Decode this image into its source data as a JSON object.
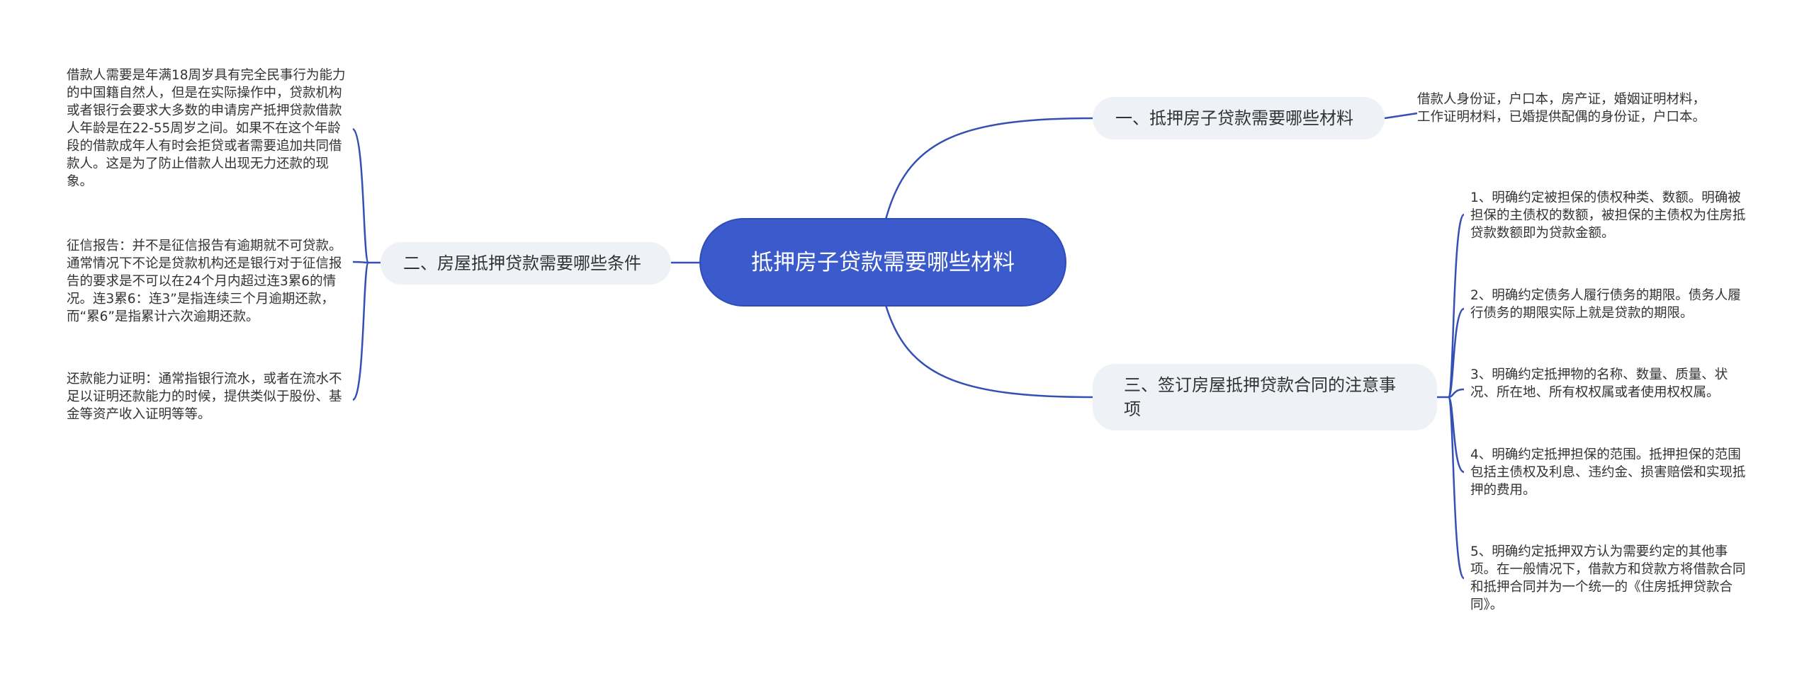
{
  "root": {
    "title": "抵押房子贷款需要哪些材料"
  },
  "branches": {
    "b1": {
      "label": "一、抵押房子贷款需要哪些材料",
      "leaves": [
        "借款人身份证，户口本，房产证，婚姻证明材料，工作证明材料，已婚提供配偶的身份证，户口本。"
      ]
    },
    "b2": {
      "label": "二、房屋抵押贷款需要哪些条件",
      "leaves": [
        "借款人需要是年满18周岁具有完全民事行为能力的中国籍自然人，但是在实际操作中，贷款机构或者银行会要求大多数的申请房产抵押贷款借款人年龄是在22-55周岁之间。如果不在这个年龄段的借款成年人有时会拒贷或者需要追加共同借款人。这是为了防止借款人出现无力还款的现象。",
        "征信报告：并不是征信报告有逾期就不可贷款。通常情况下不论是贷款机构还是银行对于征信报告的要求是不可以在24个月内超过连3累6的情况。连3累6：连3”是指连续三个月逾期还款，而“累6”是指累计六次逾期还款。",
        "还款能力证明：通常指银行流水，或者在流水不足以证明还款能力的时候，提供类似于股份、基金等资产收入证明等等。"
      ]
    },
    "b3": {
      "label": "三、签订房屋抵押贷款合同的注意事项",
      "leaves": [
        "1、明确约定被担保的债权种类、数额。明确被担保的主债权的数额，被担保的主债权为住房抵贷款数额即为贷款金额。",
        "2、明确约定债务人履行债务的期限。债务人履行债务的期限实际上就是贷款的期限。",
        "3、明确约定抵押物的名称、数量、质量、状况、所在地、所有权权属或者使用权权属。",
        "4、明确约定抵押担保的范围。抵押担保的范围包括主债权及利息、违约金、损害赔偿和实现抵押的费用。",
        "5、明确约定抵押双方认为需要约定的其他事项。在一般情况下，借款方和贷款方将借款合同和抵押合同并为一个统一的《住房抵押贷款合同》。"
      ]
    }
  },
  "colors": {
    "root_fill": "#3b5bcc",
    "branch_fill": "#eef1f5",
    "link": "#3550b5",
    "text": "#333333"
  }
}
